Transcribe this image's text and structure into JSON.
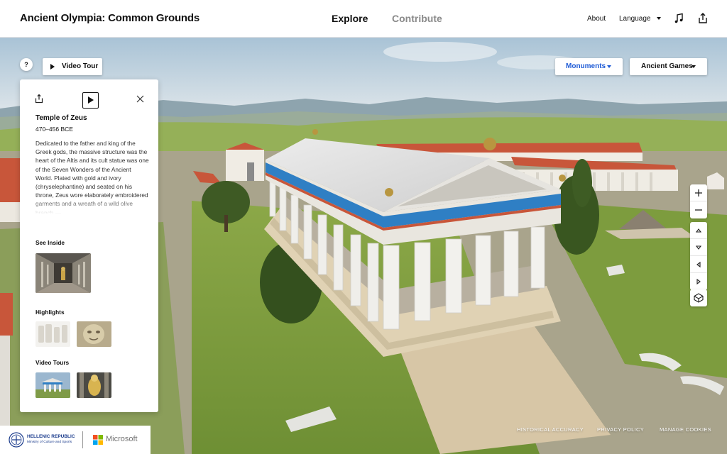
{
  "header": {
    "brand": "Ancient Olympia: Common Grounds",
    "tabs": [
      {
        "label": "Explore",
        "active": true
      },
      {
        "label": "Contribute",
        "active": false
      }
    ],
    "about_label": "About",
    "language_label": "Language",
    "music_icon": "music-note-icon",
    "share_icon": "share-icon"
  },
  "controls": {
    "help_label": "?",
    "video_tour_label": "Video Tour",
    "monuments_label": "Monuments",
    "ancient_games_label": "Ancient Games",
    "zoom_icons": [
      "plus-icon",
      "minus-icon"
    ],
    "pan_icons": [
      "arrow-up-icon",
      "arrow-down-icon",
      "arrow-left-icon",
      "arrow-right-icon"
    ],
    "view_icon": "cube-view-icon"
  },
  "panel": {
    "title": "Temple of Zeus",
    "dates": "470–456 BCE",
    "description": "Dedicated to the father and king of the Greek gods, the massive structure was the heart of the Altis and its cult statue was one of the Seven Wonders of the Ancient World. Plated with gold and ivory (chryselephantine) and seated on his throne, Zeus wore elaborately embroidered garments and a wreath of a wild olive branch —",
    "sections": {
      "see_inside": "See Inside",
      "highlights": "Highlights",
      "video_tours": "Video Tours"
    },
    "icons": [
      "share-icon",
      "play-icon",
      "close-icon"
    ]
  },
  "footer": {
    "gov_line1": "HELLENIC REPUBLIC",
    "gov_line2": "Ministry of Culture and Sports",
    "partner": "Microsoft",
    "links": [
      "HISTORICAL ACCURACY",
      "PRIVACY POLICY",
      "MANAGE COOKIES"
    ]
  },
  "colors": {
    "accent": "#1e5bd6",
    "temple_frieze": "#2f7fc4",
    "roof_tile": "#c8563a",
    "grass": "#7a9a3c"
  }
}
